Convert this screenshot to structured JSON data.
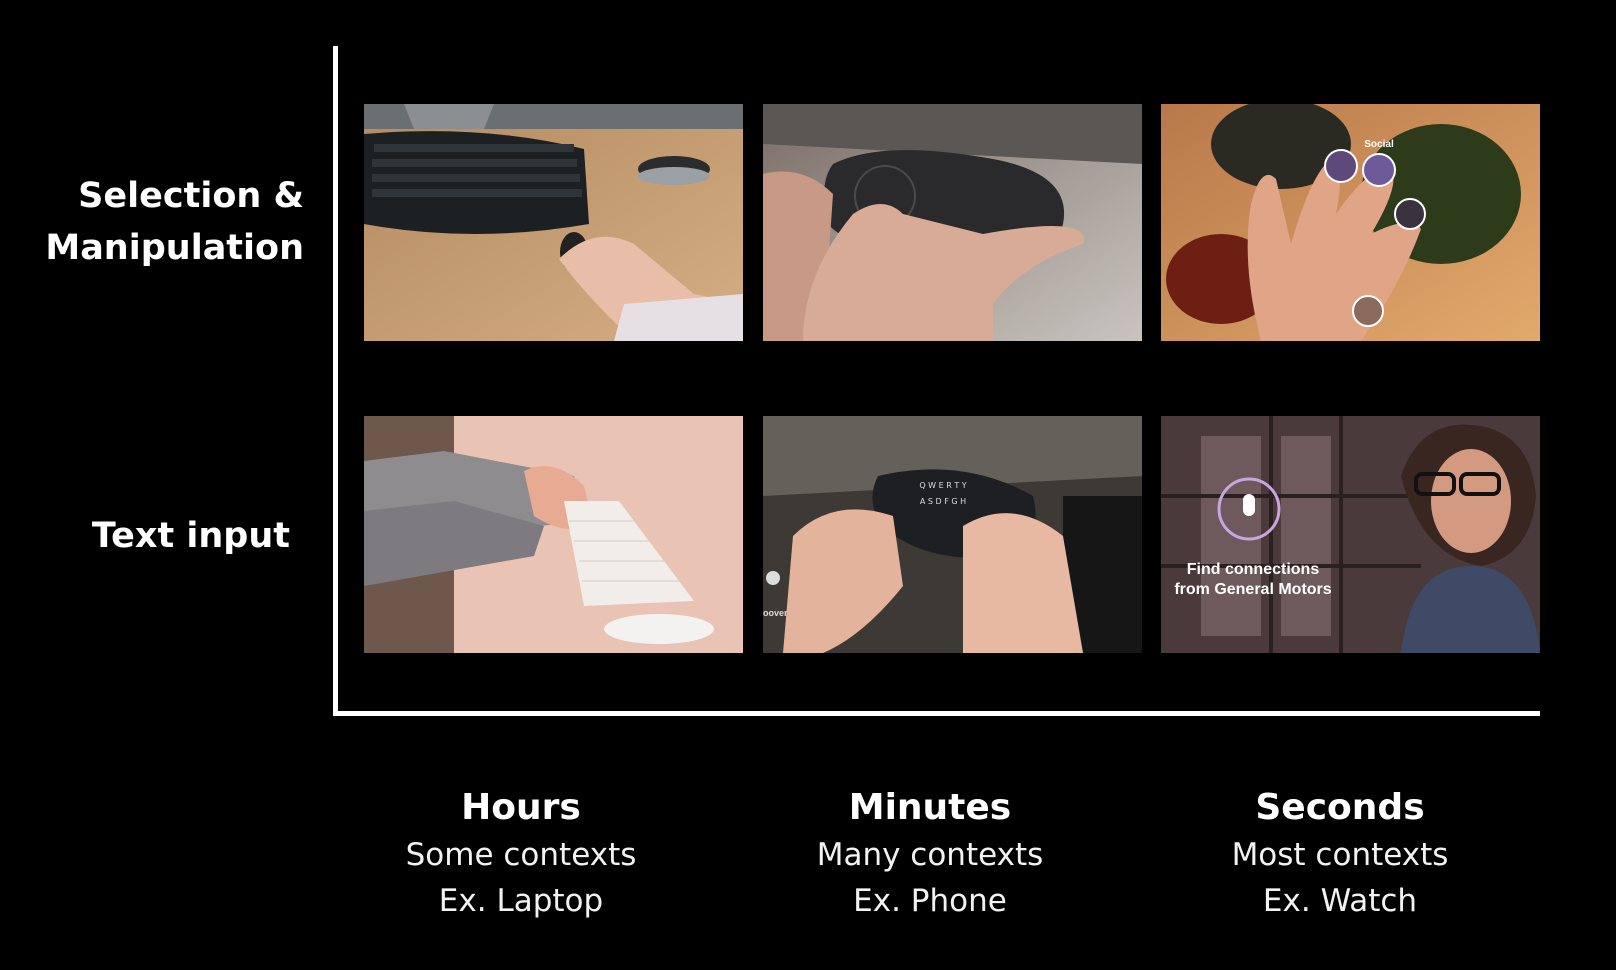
{
  "rows": [
    {
      "line1": "Selection &",
      "line2": "Manipulation"
    },
    {
      "line1": "Text input"
    }
  ],
  "columns": [
    {
      "title": "Hours",
      "context": "Some contexts",
      "example": "Ex. Laptop"
    },
    {
      "title": "Minutes",
      "context": "Many contexts",
      "example": "Ex. Phone"
    },
    {
      "title": "Seconds",
      "context": "Most contexts",
      "example": "Ex. Watch"
    }
  ],
  "overlays": {
    "social_label": "Social",
    "find_line1": "Find connections",
    "find_line2": "from General Motors",
    "keyboard_keys": "Q W E R T Y",
    "keyboard_keys2": "A S D F G H",
    "side_text": "oover"
  }
}
